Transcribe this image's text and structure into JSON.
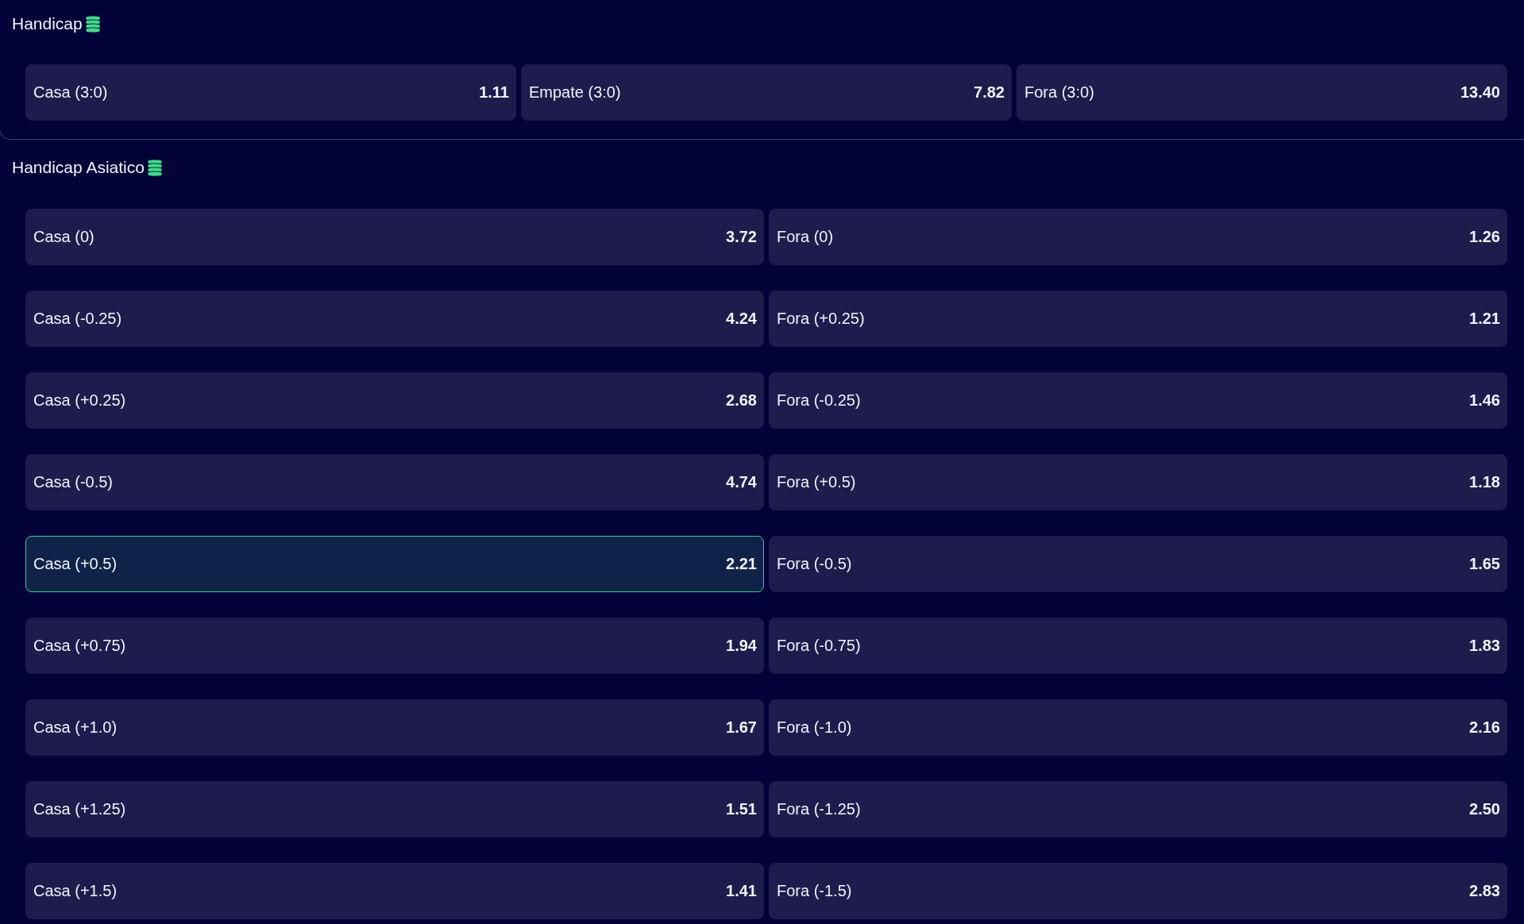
{
  "markets": [
    {
      "title": "Handicap",
      "rows": [
        {
          "outcomes": [
            {
              "label": "Casa (3:0)",
              "odds": "1.11",
              "selected": false
            },
            {
              "label": "Empate (3:0)",
              "odds": "7.82",
              "selected": false
            },
            {
              "label": "Fora (3:0)",
              "odds": "13.40",
              "selected": false
            }
          ]
        }
      ]
    },
    {
      "title": "Handicap Asiatico",
      "rows": [
        {
          "outcomes": [
            {
              "label": "Casa (0)",
              "odds": "3.72",
              "selected": false
            },
            {
              "label": "Fora (0)",
              "odds": "1.26",
              "selected": false
            }
          ]
        },
        {
          "outcomes": [
            {
              "label": "Casa (-0.25)",
              "odds": "4.24",
              "selected": false
            },
            {
              "label": "Fora (+0.25)",
              "odds": "1.21",
              "selected": false
            }
          ]
        },
        {
          "outcomes": [
            {
              "label": "Casa (+0.25)",
              "odds": "2.68",
              "selected": false
            },
            {
              "label": "Fora (-0.25)",
              "odds": "1.46",
              "selected": false
            }
          ]
        },
        {
          "outcomes": [
            {
              "label": "Casa (-0.5)",
              "odds": "4.74",
              "selected": false
            },
            {
              "label": "Fora (+0.5)",
              "odds": "1.18",
              "selected": false
            }
          ]
        },
        {
          "outcomes": [
            {
              "label": "Casa (+0.5)",
              "odds": "2.21",
              "selected": true
            },
            {
              "label": "Fora (-0.5)",
              "odds": "1.65",
              "selected": false
            }
          ]
        },
        {
          "outcomes": [
            {
              "label": "Casa (+0.75)",
              "odds": "1.94",
              "selected": false
            },
            {
              "label": "Fora (-0.75)",
              "odds": "1.83",
              "selected": false
            }
          ]
        },
        {
          "outcomes": [
            {
              "label": "Casa (+1.0)",
              "odds": "1.67",
              "selected": false
            },
            {
              "label": "Fora (-1.0)",
              "odds": "2.16",
              "selected": false
            }
          ]
        },
        {
          "outcomes": [
            {
              "label": "Casa (+1.25)",
              "odds": "1.51",
              "selected": false
            },
            {
              "label": "Fora (-1.25)",
              "odds": "2.50",
              "selected": false
            }
          ]
        },
        {
          "outcomes": [
            {
              "label": "Casa (+1.5)",
              "odds": "1.41",
              "selected": false
            },
            {
              "label": "Fora (-1.5)",
              "odds": "2.83",
              "selected": false
            }
          ]
        }
      ]
    }
  ]
}
